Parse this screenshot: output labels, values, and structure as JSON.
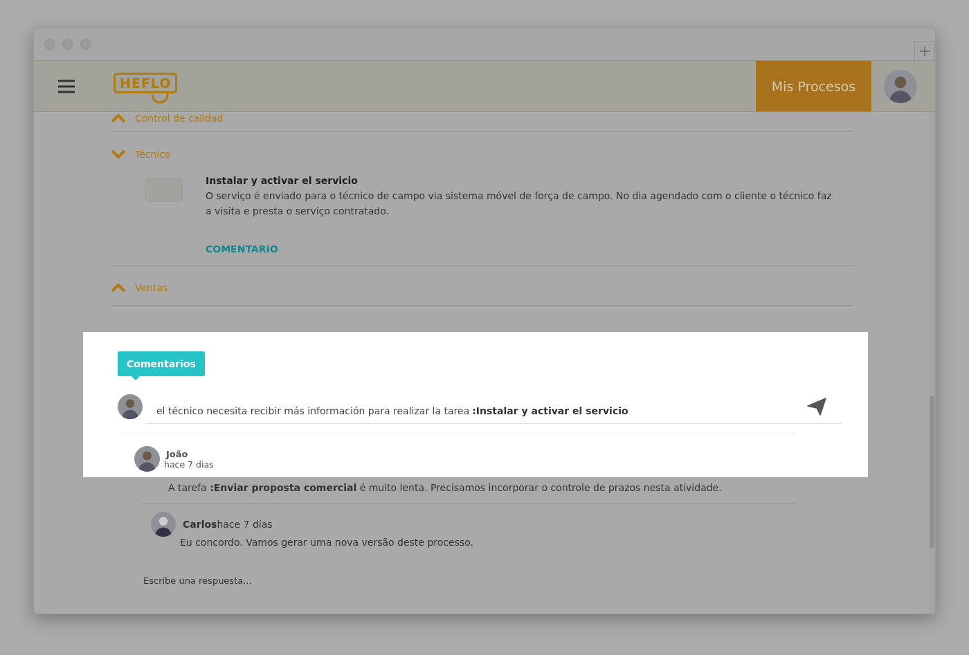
{
  "header": {
    "logo": "HEFLO",
    "nav_button": "Mis Procesos"
  },
  "sections": [
    {
      "title": "Control de calidad",
      "expanded": false
    },
    {
      "title": "Técnico",
      "expanded": true,
      "tasks": [
        {
          "title": "Instalar y activar el servicio",
          "description": "O serviço é enviado para o técnico de campo via sistema móvel de força de campo. No dia agendado com o cliente o técnico faz a visita e presta o serviço contratado.",
          "comment_link": "COMENTARIO",
          "checked": false
        }
      ]
    },
    {
      "title": "Ventas",
      "expanded": false
    }
  ],
  "comments": {
    "tab": "Comentarios",
    "input_value": "el técnico necesita recibir más información para realizar la tarea **:Instalar y activar el servicio**",
    "thread": {
      "author": "João",
      "time": "hace 7 dias",
      "text": "A tarefa **:Enviar proposta comercial** é muito lenta. Precisamos incorporar o controle de prazos nesta atividade.",
      "replies": [
        {
          "author_line": "**Carlos**hace 7 días",
          "text": "Eu concordo. Vamos gerar uma nova versão deste processo."
        }
      ],
      "reply_placeholder": "Escribe una respuesta..."
    }
  }
}
